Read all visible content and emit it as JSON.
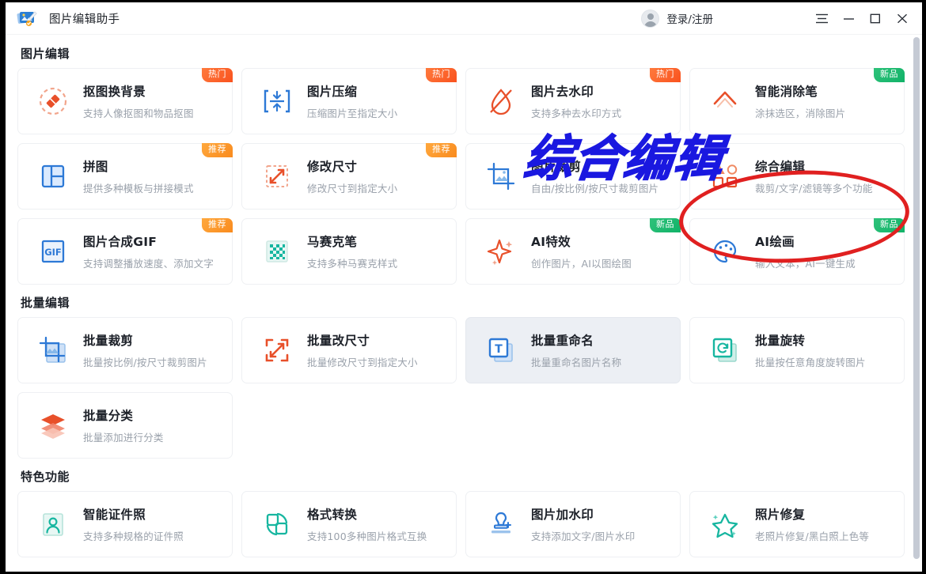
{
  "window": {
    "app_title": "图片编辑助手",
    "logo_icon": "app-logo-icon",
    "account_label": "登录/注册",
    "avatar_icon": "avatar-icon",
    "controls": [
      {
        "name": "menu-button",
        "label": "☰",
        "icon": "hamburger-menu-icon"
      },
      {
        "name": "minimize-button",
        "label": "—",
        "icon": "minimize-icon"
      },
      {
        "name": "maximize-button",
        "label": "▢",
        "icon": "maximize-icon"
      },
      {
        "name": "close-button",
        "label": "✕",
        "icon": "close-icon"
      }
    ]
  },
  "annotations": {
    "overlay_text": "综合编辑",
    "overlay_color": "#1a18e0",
    "ellipse_color": "#e02020"
  },
  "sections": [
    {
      "title": "图片编辑",
      "cards": [
        {
          "title": "抠图换背景",
          "desc": "支持人像抠图和物品抠图",
          "badge": "热门",
          "badge_type": "hot",
          "icon": "cutout-pen-icon",
          "hover": false
        },
        {
          "title": "图片压缩",
          "desc": "压缩图片至指定大小",
          "badge": "热门",
          "badge_type": "hot",
          "icon": "compress-icon",
          "hover": false
        },
        {
          "title": "图片去水印",
          "desc": "支持多种去水印方式",
          "badge": "热门",
          "badge_type": "hot",
          "icon": "remove-watermark-icon",
          "hover": false
        },
        {
          "title": "智能消除笔",
          "desc": "涂抹选区，消除图片",
          "badge": "新品",
          "badge_type": "new",
          "icon": "smart-eraser-icon",
          "hover": false
        },
        {
          "title": "拼图",
          "desc": "提供多种模板与拼接模式",
          "badge": "推荐",
          "badge_type": "rec",
          "icon": "collage-icon",
          "hover": false
        },
        {
          "title": "修改尺寸",
          "desc": "修改尺寸到指定大小",
          "badge": "推荐",
          "badge_type": "rec",
          "icon": "resize-icon",
          "hover": false
        },
        {
          "title": "图片裁剪",
          "desc": "自由/按比例/按尺寸裁剪图片",
          "badge": "",
          "badge_type": "",
          "icon": "crop-icon",
          "hover": false
        },
        {
          "title": "综合编辑",
          "desc": "裁剪/文字/滤镜等多个功能",
          "badge": "",
          "badge_type": "",
          "icon": "shapes-icon",
          "hover": false
        },
        {
          "title": "图片合成GIF",
          "desc": "支持调整播放速度、添加文字",
          "badge": "推荐",
          "badge_type": "rec",
          "icon": "gif-icon",
          "hover": false
        },
        {
          "title": "马赛克笔",
          "desc": "支持多种马赛克样式",
          "badge": "",
          "badge_type": "",
          "icon": "mosaic-icon",
          "hover": false
        },
        {
          "title": "AI特效",
          "desc": "创作图片，AI以图绘图",
          "badge": "新品",
          "badge_type": "new",
          "icon": "sparkle-icon",
          "hover": false
        },
        {
          "title": "AI绘画",
          "desc": "输入文本，AI一键生成",
          "badge": "新品",
          "badge_type": "new",
          "icon": "palette-icon",
          "hover": false
        }
      ]
    },
    {
      "title": "批量编辑",
      "cards": [
        {
          "title": "批量裁剪",
          "desc": "批量按比例/按尺寸裁剪图片",
          "badge": "",
          "badge_type": "",
          "icon": "batch-crop-icon",
          "hover": false
        },
        {
          "title": "批量改尺寸",
          "desc": "批量修改尺寸到指定大小",
          "badge": "",
          "badge_type": "",
          "icon": "batch-resize-icon",
          "hover": false
        },
        {
          "title": "批量重命名",
          "desc": "批量重命名图片名称",
          "badge": "",
          "badge_type": "",
          "icon": "batch-rename-icon",
          "hover": true
        },
        {
          "title": "批量旋转",
          "desc": "批量按任意角度旋转图片",
          "badge": "",
          "badge_type": "",
          "icon": "batch-rotate-icon",
          "hover": false
        },
        {
          "title": "批量分类",
          "desc": "批量添加进行分类",
          "badge": "",
          "badge_type": "",
          "icon": "batch-classify-icon",
          "hover": false
        }
      ]
    },
    {
      "title": "特色功能",
      "cards": [
        {
          "title": "智能证件照",
          "desc": "支持多种规格的证件照",
          "badge": "",
          "badge_type": "",
          "icon": "id-photo-icon",
          "hover": false
        },
        {
          "title": "格式转换",
          "desc": "支持100多种图片格式互换",
          "badge": "",
          "badge_type": "",
          "icon": "format-convert-icon",
          "hover": false
        },
        {
          "title": "图片加水印",
          "desc": "支持添加文字/图片水印",
          "badge": "",
          "badge_type": "",
          "icon": "add-watermark-icon",
          "hover": false
        },
        {
          "title": "照片修复",
          "desc": "老照片修复/黑白照上色等",
          "badge": "",
          "badge_type": "",
          "icon": "photo-restore-icon",
          "hover": false
        }
      ]
    }
  ]
}
